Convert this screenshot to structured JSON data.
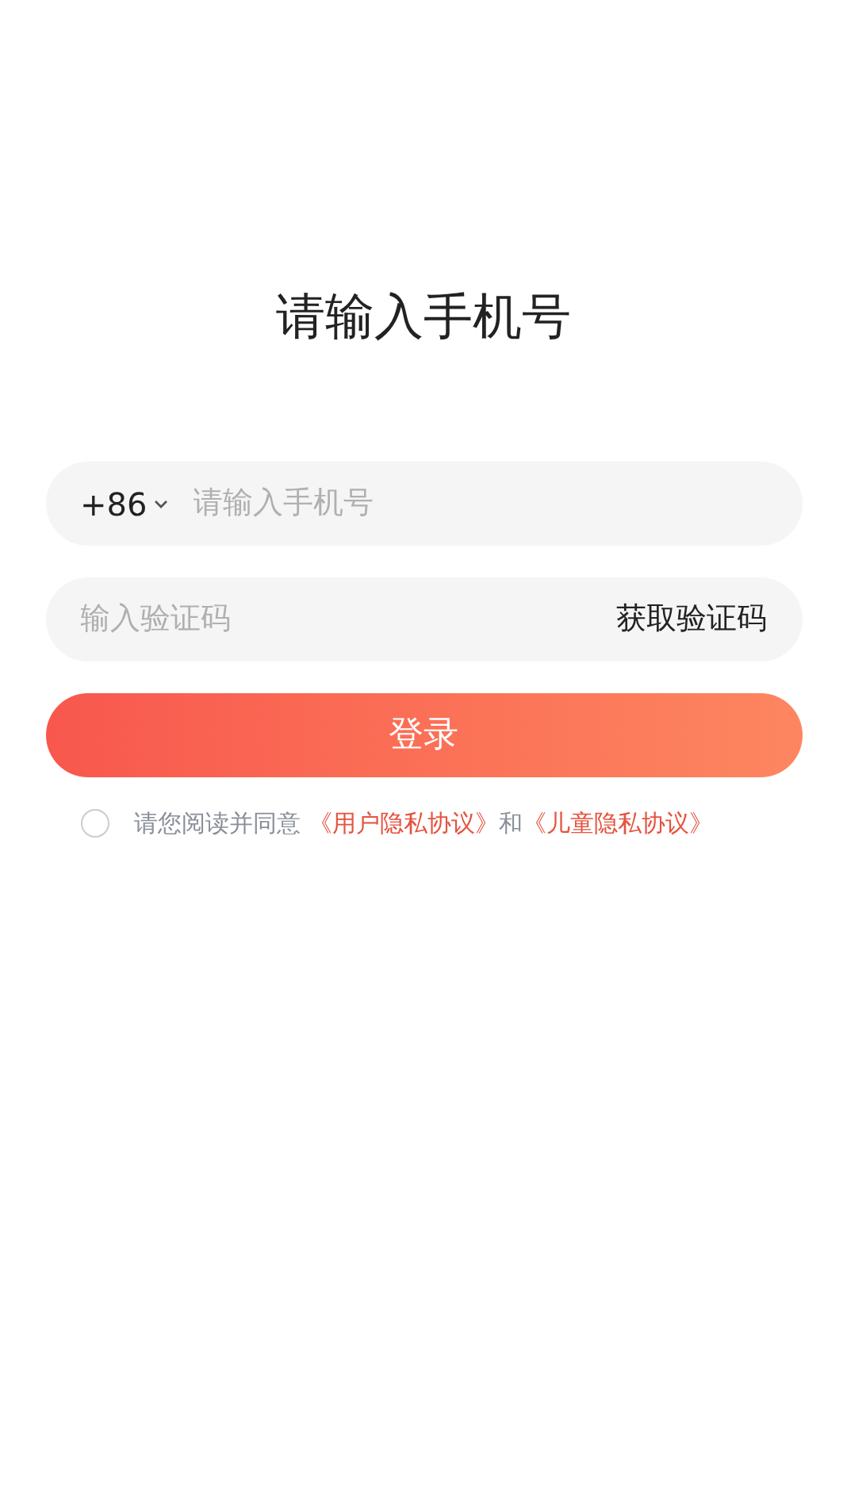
{
  "title": "请输入手机号",
  "phone": {
    "country_code": "+86",
    "placeholder": "请输入手机号"
  },
  "code": {
    "placeholder": "输入验证码",
    "action": "获取验证码"
  },
  "login_button": "登录",
  "agreement": {
    "checked": false,
    "parts": [
      {
        "kind": "text",
        "text": "请您阅读并同意 "
      },
      {
        "kind": "link",
        "text": "《用户隐私协议》"
      },
      {
        "kind": "text",
        "text": "和"
      },
      {
        "kind": "link",
        "text": "《儿童隐私协议》"
      }
    ]
  }
}
